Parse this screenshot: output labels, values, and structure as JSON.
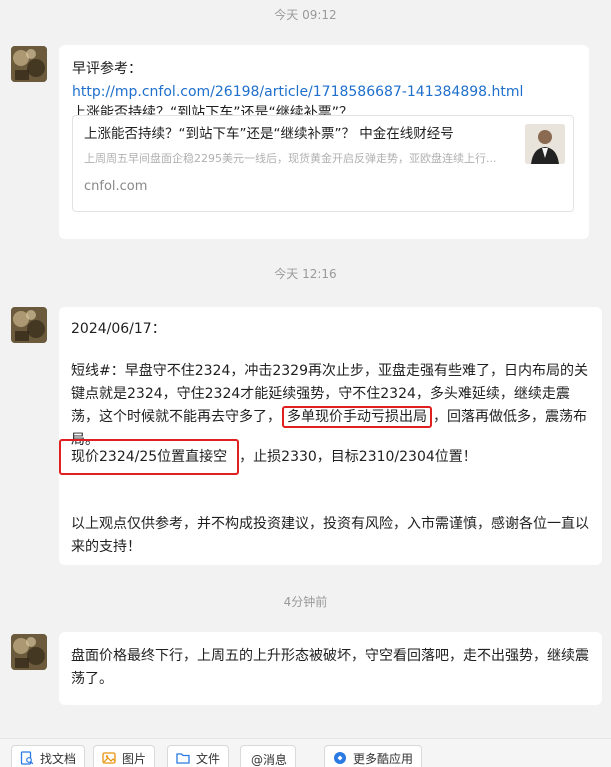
{
  "timestamps": [
    "今天 09:12",
    "今天 12:16",
    "4分钟前"
  ],
  "msg1": {
    "line1": "早评参考：",
    "url": "http://mp.cnfol.com/26198/article/1718586687-141384898.html",
    "line3": "上涨能否持续？“到站下车”还是“继续补票”？",
    "card": {
      "title": "上涨能否持续？“到站下车”还是“继续补票”？  中金在线财经号",
      "desc": "上周周五早间盘面企稳2295美元一线后，现货黄金开启反弹走势，亚欧盘连续上行...",
      "source": "cnfol.com"
    }
  },
  "msg2": {
    "date": "2024/06/17：",
    "para1_a": "短线#：早盘守不住2324，冲击2329再次止步，亚盘走强有些难了，日内布局的关键点就是2324，守住2324才能延续强势，守不住2324，多头难延续，继续走震荡，这个时候就不能再去守多了，",
    "para1_hl": "多单现价手动亏损出局",
    "para1_b": "，回落再做低多，震荡布局。",
    "para2_hl": "现价2324/25位置直接空",
    "para2_b": "，止损2330，目标2310/2304位置！",
    "para3": "以上观点仅供参考，并不构成投资建议，投资有风险，入市需谨慎，感谢各位一直以来的支持！"
  },
  "msg3": {
    "text": "盘面价格最终下行，上周五的上升形态被破坏，守空看回落吧，走不出强势，继续震荡了。"
  },
  "toolbar": {
    "buttons": [
      "找文档",
      "图片",
      "文件",
      "@消息",
      "更多酷应用"
    ]
  },
  "colors": {
    "link": "#1f6fcc",
    "highlight_border": "#e02020",
    "background": "#f2f2f2"
  }
}
